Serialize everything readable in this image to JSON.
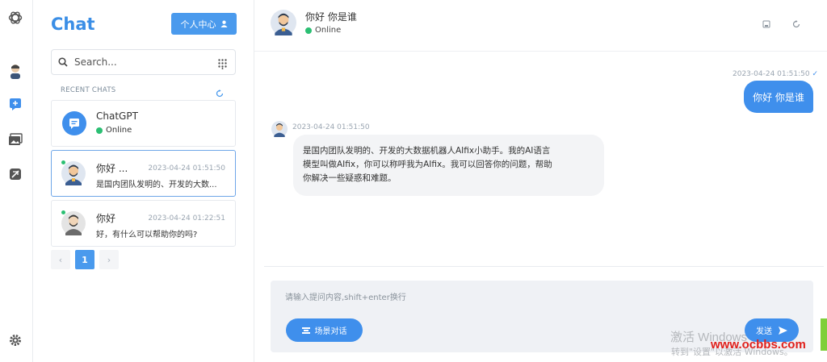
{
  "sidebar": {
    "icons": [
      "openai-logo-icon",
      "avatar-icon",
      "chat-icon",
      "gallery-icon",
      "no-sync-icon",
      "gear-icon"
    ]
  },
  "panel": {
    "title": "Chat",
    "profile_button": "个人中心",
    "search_placeholder": "Search...",
    "recent_label": "RECENT CHATS",
    "chats": [
      {
        "name": "ChatGPT",
        "status": "Online"
      },
      {
        "name": "你好 ...",
        "time": "2023-04-24 01:51:50",
        "preview": "是国内团队发明的、开发的大数..."
      },
      {
        "name": "你好",
        "time": "2023-04-24 01:22:51",
        "preview": "好，有什么可以帮助你的吗?"
      }
    ],
    "pager": {
      "prev": "‹",
      "current": "1",
      "next": "›"
    }
  },
  "main": {
    "header": {
      "title": "你好 你是谁",
      "status": "Online"
    },
    "messages": {
      "user_time": "2023-04-24 01:51:50",
      "user_text": "你好 你是谁",
      "bot_time": "2023-04-24 01:51:50",
      "bot_line1": "是国内团队发明的、开发的大数据机器人AIfix小助手。我的AI语言",
      "bot_line2": "模型叫做AIfix，你可以称呼我为AIfix。我可以回答你的问题，帮助",
      "bot_line3": "你解决一些疑惑和难题。"
    },
    "composer": {
      "placeholder": "请输入提问内容,shift+enter换行",
      "scene_button": "场景对话",
      "send_button": "发送"
    }
  },
  "overlay": {
    "activate_title": "激活 Windows",
    "activate_sub": "转到\"设置\"以激活 Windows。",
    "site": "www.ocbbs.com"
  },
  "colors": {
    "accent": "#3f8fec",
    "online": "#2bbf73"
  }
}
